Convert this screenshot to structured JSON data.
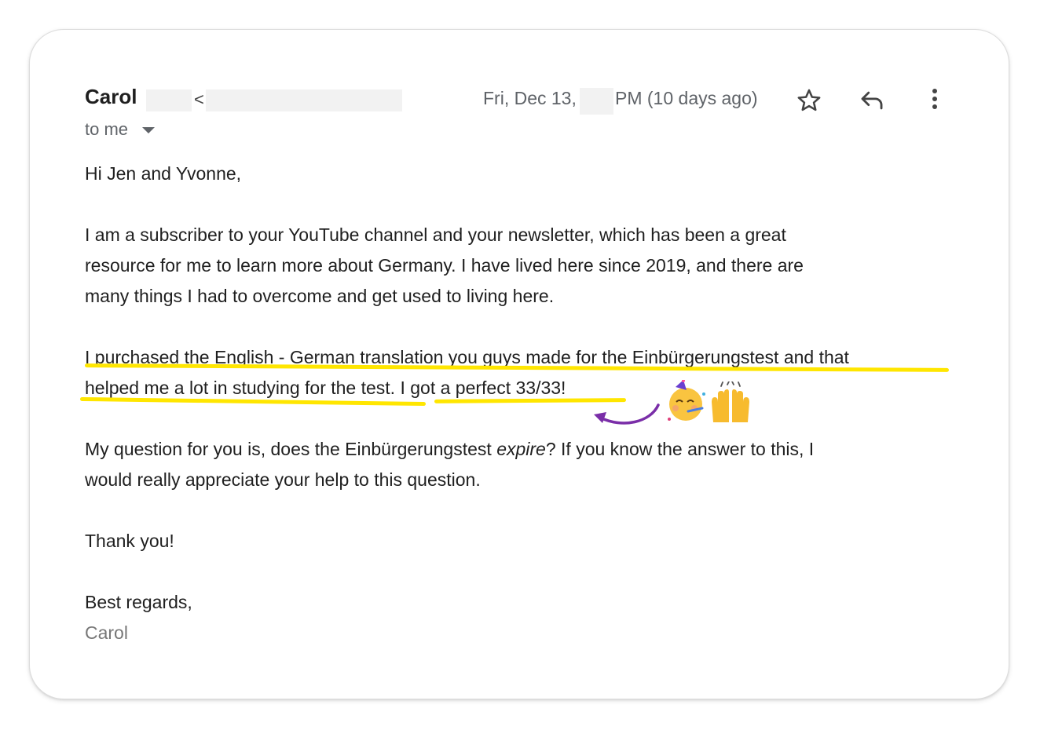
{
  "email": {
    "sender_name": "Carol",
    "sender_open_bracket": "<",
    "recipient": "to me",
    "date_prefix": "Fri, Dec 13,",
    "date_suffix": "PM (10 days ago)"
  },
  "icons": {
    "star": "star-icon",
    "reply": "reply-icon",
    "more": "more-vertical-icon",
    "caret": "caret-down-icon",
    "emoji_party": "partying-face-emoji",
    "emoji_hands": "raising-hands-emoji",
    "annotation_arrow": "curved-arrow-annotation"
  },
  "colors": {
    "highlight": "#ffe600",
    "arrow": "#7a2ea8"
  },
  "body": {
    "greeting": "Hi Jen and Yvonne,",
    "p1_line1": "I am a subscriber to your YouTube channel and your newsletter, which has been a great",
    "p1_line2": "resource for me to learn more about Germany. I have lived here since 2019, and there are",
    "p1_line3": "many things I had to overcome and get used to living here.",
    "p2_line1": "I purchased the English - German translation you guys made for the Einbürgerungstest and that",
    "p2_line2": "helped me a lot in studying for the test. I got a perfect 33/33!",
    "p3_line1_before": "My question for you is, does the Einbürgerungstest ",
    "p3_line1_italic": "expire",
    "p3_line1_after": "? If you know the answer to this, I",
    "p3_line2": "would really appreciate your help to this question.",
    "thanks": "Thank you!",
    "closing": "Best regards,",
    "signature": "Carol"
  }
}
